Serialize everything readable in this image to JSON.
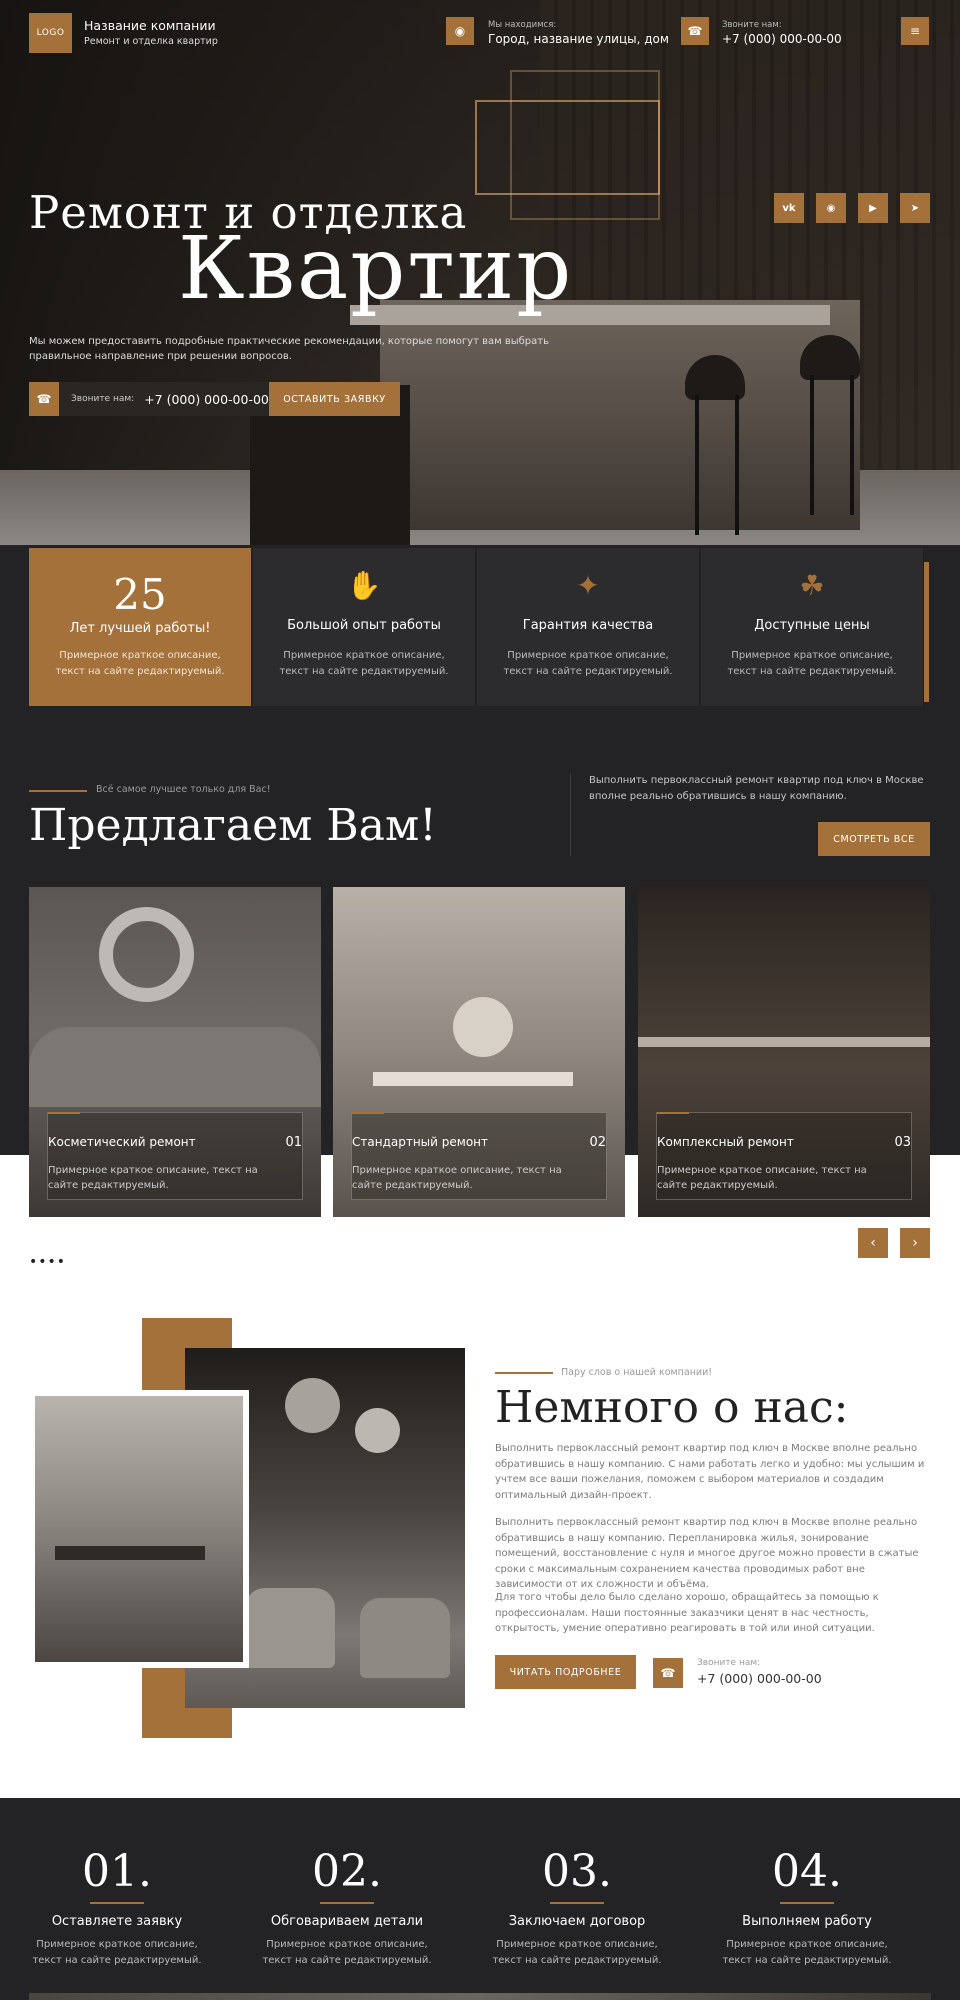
{
  "header": {
    "logo": "LOGO",
    "company_name": "Название компании",
    "company_sub": "Ремонт и отделка квартир",
    "location_label": "Мы находимся:",
    "location_value": "Город, название улицы, дом",
    "phone_label": "Звоните нам:",
    "phone_value": "+7 (000) 000-00-00"
  },
  "hero": {
    "title_line1": "Ремонт и отделка",
    "title_line2": "Квартир",
    "lead": "Мы можем предоставить подробные практические рекомендации, которые помогут вам выбрать правильное направление при решении  вопросов.",
    "call_label": "Звоните нам:",
    "call_value": "+7 (000) 000-00-00",
    "cta": "ОСТАВИТЬ ЗАЯВКУ",
    "social": [
      {
        "icon": "vk-icon",
        "glyph": "vk"
      },
      {
        "icon": "whatsapp-icon",
        "glyph": "◉"
      },
      {
        "icon": "youtube-icon",
        "glyph": "▶"
      },
      {
        "icon": "telegram-icon",
        "glyph": "➤"
      }
    ]
  },
  "features": [
    {
      "value": "25",
      "title": "Лет лучшей работы!",
      "desc": "Примерное краткое описание, текст на сайте редактируемый."
    },
    {
      "icon": "thumbs-up-icon",
      "title": "Большой опыт работы",
      "desc": "Примерное краткое описание, текст на сайте редактируемый."
    },
    {
      "icon": "quality-shield-icon",
      "title": "Гарантия качества",
      "desc": "Примерное краткое описание, текст на сайте редактируемый."
    },
    {
      "icon": "price-tag-icon",
      "title": "Доступные цены",
      "desc": "Примерное краткое описание, текст на сайте редактируемый."
    }
  ],
  "offer": {
    "eyebrow": "Всё самое лучшее только для Вас!",
    "title": "Предлагаем Вам!",
    "desc": "Выполнить первоклассный ремонт квартир под ключ в Москве вполне реально обратившись в нашу компанию.",
    "button": "СМОТРЕТЬ ВСЕ",
    "cards": [
      {
        "title": "Косметический ремонт",
        "num": "01",
        "desc": "Примерное краткое описание, текст на сайте редактируемый."
      },
      {
        "title": "Стандартный ремонт",
        "num": "02",
        "desc": "Примерное краткое описание, текст на сайте редактируемый."
      },
      {
        "title": "Комплексный ремонт",
        "num": "03",
        "desc": "Примерное краткое описание, текст на сайте редактируемый."
      }
    ]
  },
  "about": {
    "eyebrow": "Пару слов о нашей компании!",
    "title": "Немного о нас:",
    "p1": "Выполнить первоклассный ремонт квартир под ключ в Москве вполне реально обратившись в нашу компанию. С нами работать легко и удобно: мы услышим и учтем все ваши пожелания, поможем с выбором материалов и создадим оптимальный дизайн-проект.",
    "p2": "Выполнить первоклассный ремонт квартир под ключ в Москве вполне реально обратившись в нашу компанию. Перепланировка жилья, зонирование помещений, восстановление с нуля и многое другое можно провести в сжатые сроки с максимальным сохранением качества проводимых работ вне зависимости от их сложности и объёма.",
    "p3": "Для того чтобы дело было сделано хорошо, обращайтесь за помощью к профессионалам. Наши постоянные заказчики ценят в нас честность, открытость, умение оперативно реагировать в той или иной ситуации.",
    "button": "ЧИТАТЬ ПОДРОБНЕЕ",
    "phone_label": "Звоните нам:",
    "phone_value": "+7 (000) 000-00-00"
  },
  "steps": [
    {
      "num": "01.",
      "title": "Оставляете заявку",
      "desc": "Примерное краткое описание, текст на сайте редактируемый."
    },
    {
      "num": "02.",
      "title": "Обговариваем детали",
      "desc": "Примерное краткое описание, текст на сайте редактируемый."
    },
    {
      "num": "03.",
      "title": "Заключаем договор",
      "desc": "Примерное краткое описание, текст на сайте редактируемый."
    },
    {
      "num": "04.",
      "title": "Выполняем работу",
      "desc": "Примерное краткое описание, текст на сайте редактируемый."
    }
  ],
  "colors": {
    "accent": "#a4713b",
    "dark": "#232325"
  }
}
